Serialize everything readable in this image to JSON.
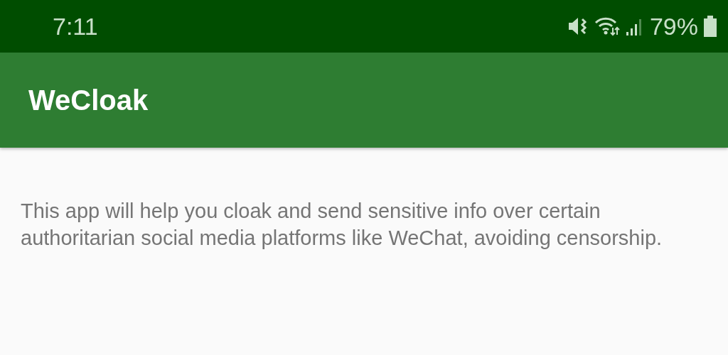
{
  "status_bar": {
    "time": "7:11",
    "battery": "79%"
  },
  "app_bar": {
    "title": "WeCloak"
  },
  "body": {
    "text": "This app will help you cloak and send sensitive info over certain authoritarian social media platforms like WeChat, avoiding censorship."
  }
}
